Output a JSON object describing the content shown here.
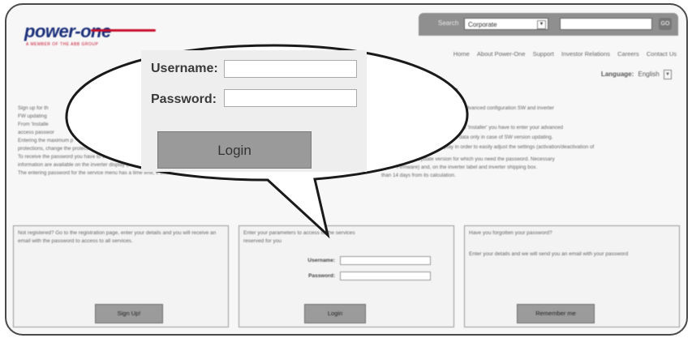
{
  "logo": {
    "brand": "power-one",
    "tagline": "A MEMBER OF THE ABB GROUP"
  },
  "search": {
    "label": "Search",
    "scope": "Corporate",
    "go_label": "GO"
  },
  "nav": {
    "items": [
      "Home",
      "About Power-One",
      "Support",
      "Investor Relations",
      "Careers",
      "Contact Us"
    ]
  },
  "language": {
    "label": "Language:",
    "value": "English"
  },
  "content": {
    "services_question": "vices?",
    "paragraphs": [
      "Sign up for th",
      "FW updating",
      "From 'Installe",
      "access passwor",
      "Entering the maximum p",
      "protections, change the protecti",
      "To receive the password you have to enter the s",
      "information are available on the inverter display (INFORMATION menu",
      "The entering password for the service menu has a time limit; it does not"
    ],
    "paragraph_tails": [
      "ew download the advanced configuration SW and inverter",
      "s. To log in as 'Installer' you have to enter your advanced",
      "figuration data only in case of SW version updating.",
      "er display in order to easily adjust the settings (activation/deactivation of",
      "ction week) and the Update version for which you need the password. Necessary",
      "INFORMATION -> Firmware) and, on the inverter label and inverter shipping box.",
      "than 14 days from its calculation."
    ]
  },
  "boxes": {
    "register": {
      "text": "Not registered? Go to the registration page, enter your details and you will receive an email with the password to access to all services.",
      "button": "Sign Up!"
    },
    "login": {
      "text": "Enter your parameters to access to the services reserved for you",
      "username_label": "Username:",
      "password_label": "Password:",
      "button": "Login"
    },
    "forgot": {
      "title": "Have you forgotten your password?",
      "text": "Enter your details and we will send you an email with your password",
      "button": "Remember me"
    }
  },
  "zoom": {
    "username_label": "Username:",
    "password_label": "Password:",
    "button": "Login"
  }
}
